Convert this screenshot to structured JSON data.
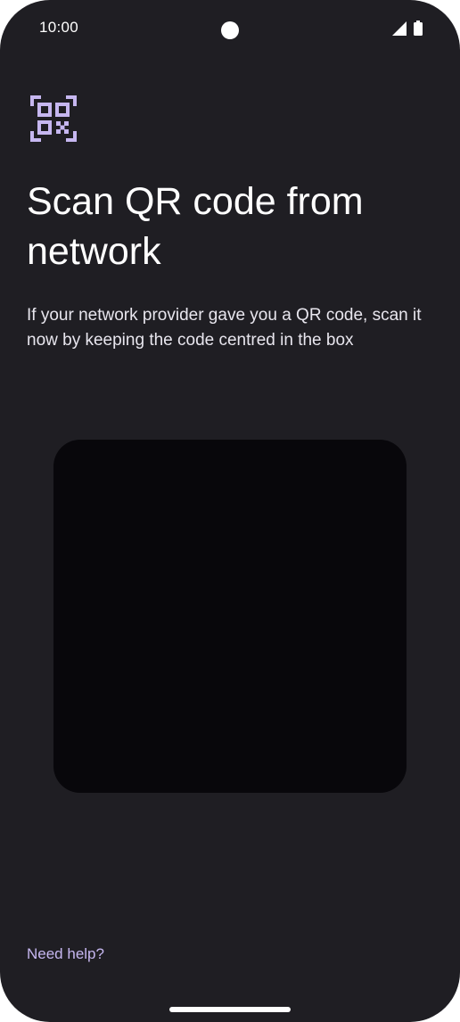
{
  "status_bar": {
    "time": "10:00",
    "icons": [
      "signal-icon",
      "battery-icon"
    ]
  },
  "header": {
    "icon": "qr-code-scanner-icon",
    "title": "Scan QR code from network"
  },
  "description": "If your network provider gave you a QR code, scan it now by keeping the code centred in the box",
  "footer": {
    "help_label": "Need help?"
  },
  "colors": {
    "background": "#1f1e23",
    "accent": "#c6b7f0",
    "scanner_background": "#08070b",
    "text_primary": "#ffffff"
  }
}
